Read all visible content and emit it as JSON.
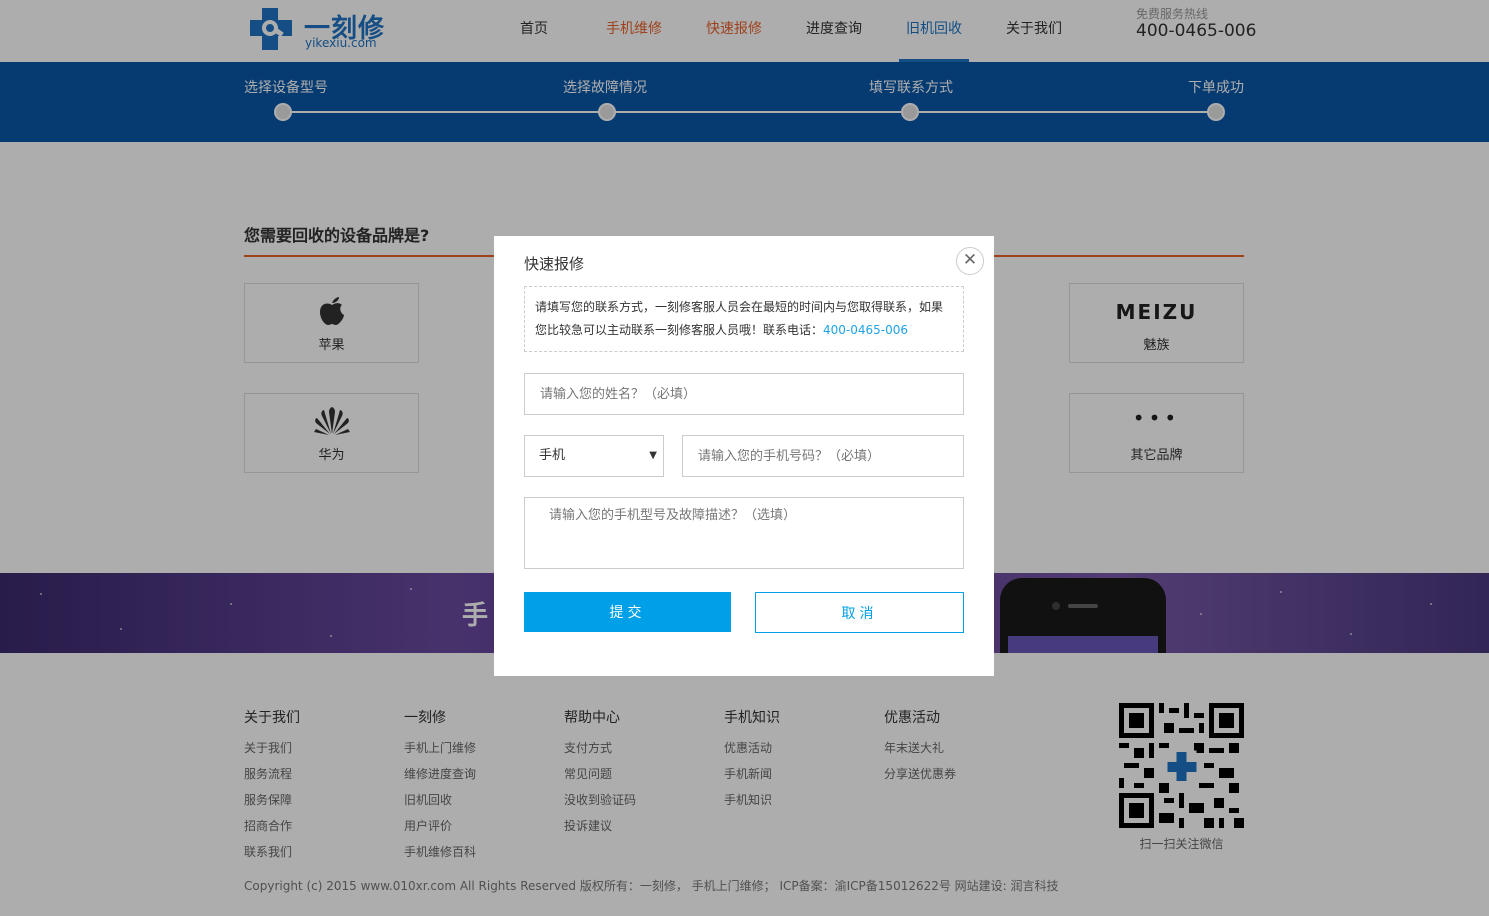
{
  "header": {
    "logo_cn": "一刻修",
    "logo_en": "yikexiu.com",
    "nav": [
      {
        "label": "首页"
      },
      {
        "label": "手机维修"
      },
      {
        "label": "快速报修"
      },
      {
        "label": "进度查询"
      },
      {
        "label": "旧机回收"
      },
      {
        "label": "关于我们"
      }
    ],
    "hotline_label": "免费服务热线",
    "hotline": "400-0465-006"
  },
  "steps": [
    {
      "label": "选择设备型号"
    },
    {
      "label": "选择故障情况"
    },
    {
      "label": "填写联系方式"
    },
    {
      "label": "下单成功"
    }
  ],
  "main": {
    "title": "您需要回收的设备品牌是?",
    "brands": [
      {
        "name": "苹果",
        "icon": "apple-icon"
      },
      {
        "name": "魅族",
        "icon": "meizu-logo",
        "logo_text": "MEIZU"
      },
      {
        "name": "华为",
        "icon": "huawei-icon"
      },
      {
        "name": "其它品牌",
        "icon": "more-icon",
        "logo_text": "•••"
      }
    ]
  },
  "banner": {
    "text": "手"
  },
  "modal": {
    "title": "快速报修",
    "close": "✕",
    "notice": "请填写您的联系方式，一刻修客服人员会在最短的时间内与您取得联系，如果您比较急可以主动联系一刻修客服人员哦！联系电话：",
    "notice_tel": "400-0465-006",
    "name_placeholder": "请输入您的姓名？（必填）",
    "device_type": "手机",
    "device_arrow": "▼",
    "phone_placeholder": "请输入您的手机号码？（必填）",
    "desc_placeholder": "请输入您的手机型号及故障描述？（选填）",
    "submit": "提交",
    "cancel": "取消"
  },
  "footer": {
    "columns": [
      {
        "title": "关于我们",
        "links": [
          "关于我们",
          "服务流程",
          "服务保障",
          "招商合作",
          "联系我们"
        ]
      },
      {
        "title": "一刻修",
        "links": [
          "手机上门维修",
          "维修进度查询",
          "旧机回收",
          "用户评价",
          "手机维修百科"
        ]
      },
      {
        "title": "帮助中心",
        "links": [
          "支付方式",
          "常见问题",
          "没收到验证码",
          "投诉建议"
        ]
      },
      {
        "title": "手机知识",
        "links": [
          "优惠活动",
          "手机新闻",
          "手机知识"
        ]
      },
      {
        "title": "优惠活动",
        "links": [
          "年末送大礼",
          "分享送优惠券"
        ]
      }
    ],
    "qr_caption": "扫一扫关注微信",
    "copyright": "Copyright (c) 2015 www.010xr.com All Rights Reserved   版权所有：一刻修，  手机上门维修；  ICP备案：渝ICP备15012622号  网站建设: 润言科技"
  }
}
